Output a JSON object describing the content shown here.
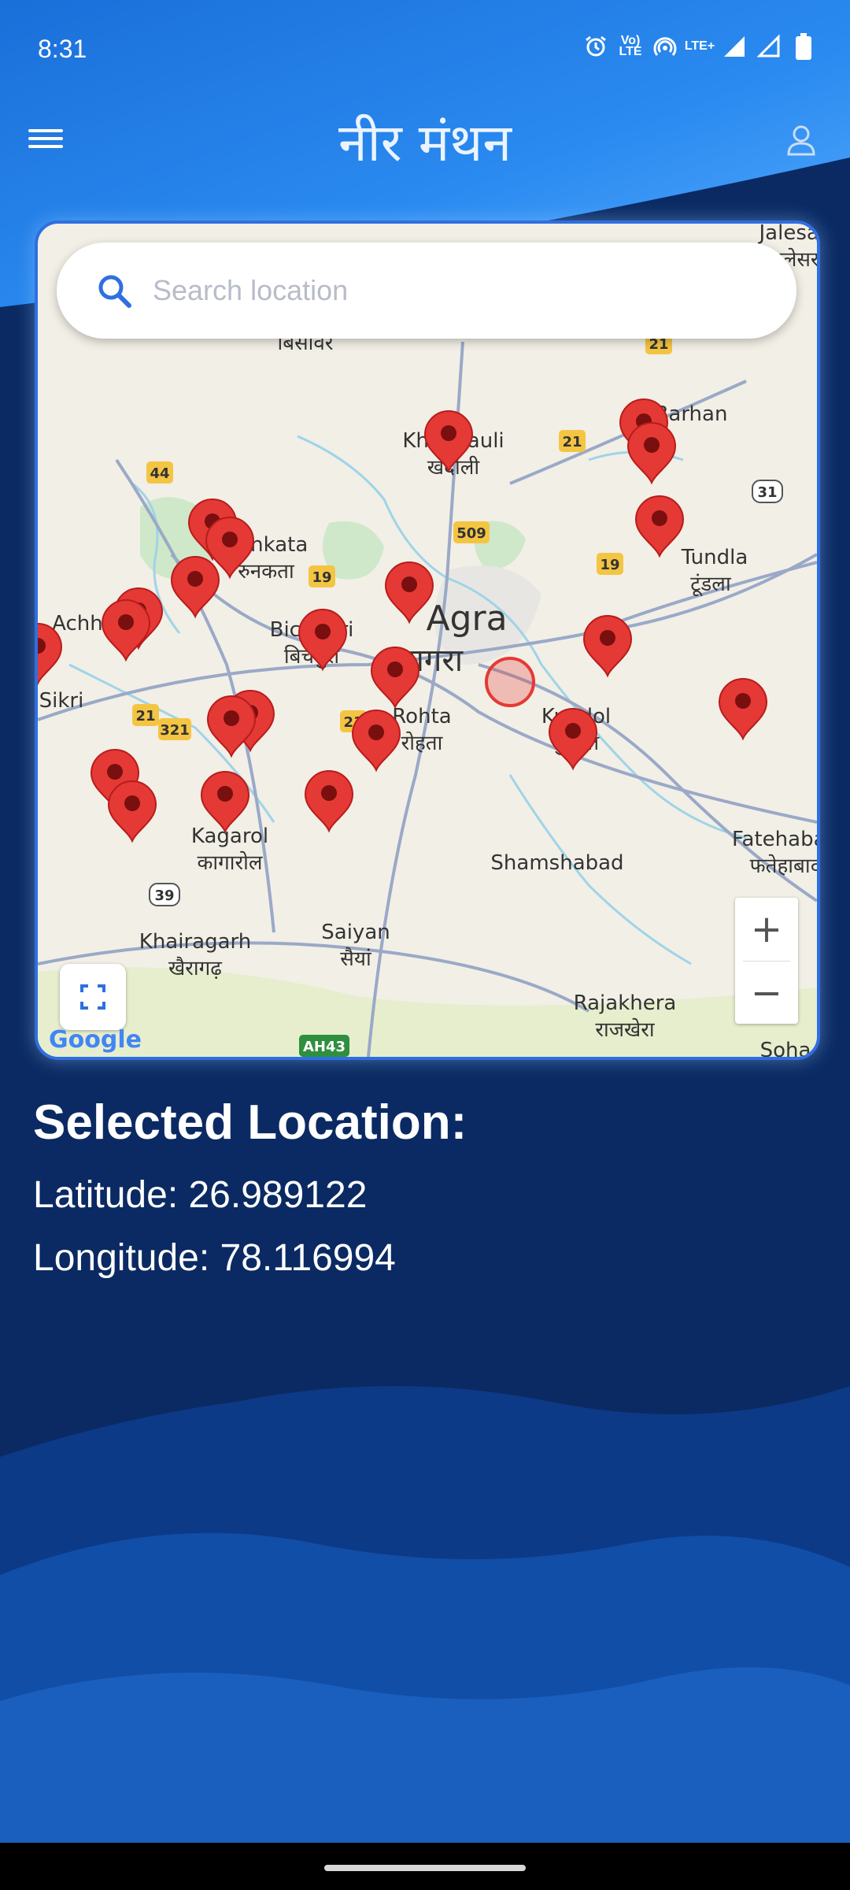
{
  "status_bar": {
    "time": "8:31",
    "vo_lte_label": "Vo) LTE",
    "lte_plus_label": "LTE+",
    "icons": [
      "alarm-icon",
      "volte-icon",
      "hotspot-icon",
      "lte-plus-icon",
      "signal-icon",
      "signal-outline-icon",
      "battery-icon"
    ]
  },
  "app_bar": {
    "title": "नीर मंथन",
    "menu_icon": "hamburger-menu-icon",
    "profile_icon": "person-icon"
  },
  "search": {
    "placeholder": "Search location",
    "value": ""
  },
  "map": {
    "places": [
      {
        "label": "Agra",
        "sub": "आगरा"
      },
      {
        "label": "Khandauli",
        "sub": "खंदौली"
      },
      {
        "label": "Tundla",
        "sub": "टूंडला"
      },
      {
        "label": "Bichpuri",
        "sub": "बिचपुरी"
      },
      {
        "label": "Kundol",
        "sub": "कुंडोल"
      },
      {
        "label": "Shamshabad",
        "sub": ""
      },
      {
        "label": "Kagarol",
        "sub": "कागारोल"
      },
      {
        "label": "Khairagarh",
        "sub": "खैरागढ़"
      },
      {
        "label": "Rajakhera",
        "sub": "राजखेरा"
      },
      {
        "label": "Fatehabad",
        "sub": "फतेहाबाद"
      },
      {
        "label": "Achhnera",
        "sub": ""
      },
      {
        "label": "Sikri",
        "sub": ""
      },
      {
        "label": "Runkata",
        "sub": "रुनकता"
      },
      {
        "label": "Bisawar",
        "sub": "बिसावर"
      },
      {
        "label": "Saiyan",
        "sub": "सैयां"
      },
      {
        "label": "Rohta",
        "sub": "रोहता"
      },
      {
        "label": "Barhan",
        "sub": ""
      },
      {
        "label": "Jalesar",
        "sub": "जलेसर"
      },
      {
        "label": "Soha",
        "sub": ""
      }
    ],
    "highway_labels": [
      "44",
      "509",
      "21",
      "19",
      "31",
      "321",
      "39",
      "AH43"
    ],
    "zoom_in_label": "+",
    "zoom_out_label": "−",
    "attribution": "Google",
    "accent_color": "#2f6fe0",
    "pin_color": "#e53935"
  },
  "selected_location": {
    "heading": "Selected Location:",
    "latitude_text": "Latitude: 26.989122",
    "longitude_text": "Longitude: 78.116994",
    "latitude": 26.989122,
    "longitude": 78.116994
  }
}
